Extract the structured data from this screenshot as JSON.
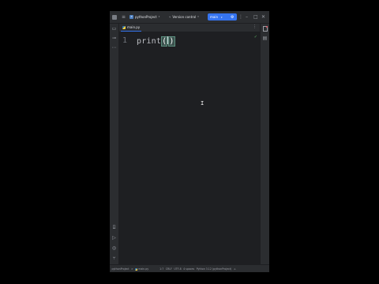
{
  "titlebar": {
    "logo_icon": "ide-logo-icon",
    "menu_icon": "hamburger-icon",
    "project_badge": "P",
    "project_name": "pythonProject",
    "vcs_label": "Version control",
    "run_config": "main",
    "window_controls": [
      "more",
      "minimize",
      "maximize",
      "close"
    ]
  },
  "left_strip": {
    "top_icons": [
      "folder-icon",
      "commit-icon",
      "more-tools-icon"
    ],
    "bottom_icons": [
      "python-console-icon",
      "run-icon",
      "problems-icon",
      "git-icon"
    ]
  },
  "right_strip": {
    "icons": [
      "notifications-icon",
      "database-icon"
    ]
  },
  "editor": {
    "tab_label": "main.py",
    "line_number": "1",
    "code_prefix": "print",
    "paren_open": "(",
    "paren_close": ")"
  },
  "statusbar": {
    "breadcrumb_project": "pythonProject",
    "breadcrumb_sep": ">",
    "breadcrumb_file": "main.py",
    "position": "1:7",
    "line_sep": "CRLF",
    "encoding": "UTF-8",
    "indent": "4 spaces",
    "interpreter": "Python 3.12 (pythonProject)"
  }
}
